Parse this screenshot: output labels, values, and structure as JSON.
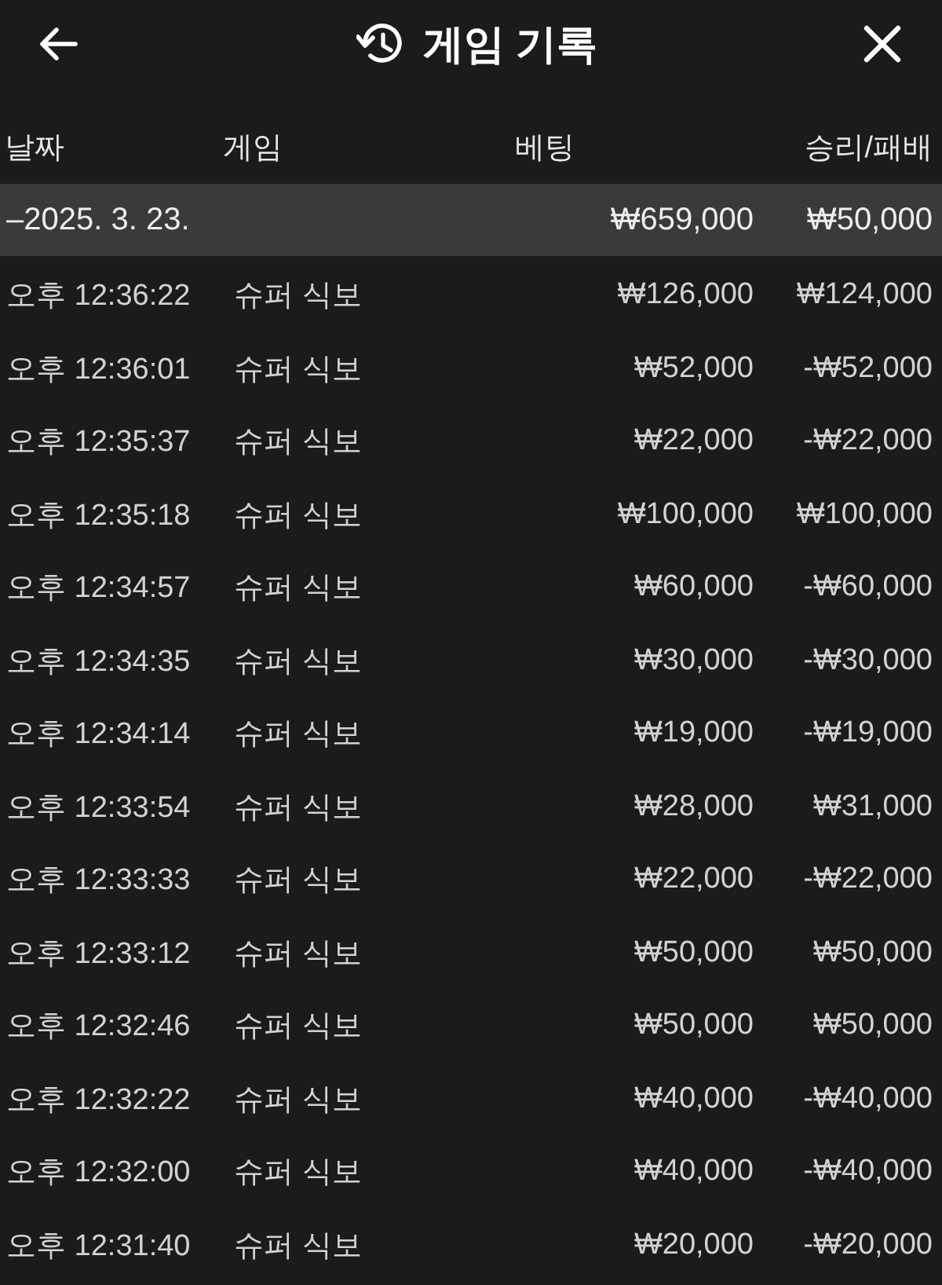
{
  "header": {
    "title": "게임 기록"
  },
  "columns": [
    "날짜",
    "게임",
    "베팅",
    "승리/패배"
  ],
  "groups": [
    {
      "date": "–2025. 3. 23.",
      "bet_total": "₩659,000",
      "result_total": "₩50,000",
      "rows": [
        {
          "time": "오후 12:36:22",
          "game": "슈퍼 식보",
          "bet": "₩126,000",
          "result": "₩124,000"
        },
        {
          "time": "오후 12:36:01",
          "game": "슈퍼 식보",
          "bet": "₩52,000",
          "result": "-₩52,000"
        },
        {
          "time": "오후 12:35:37",
          "game": "슈퍼 식보",
          "bet": "₩22,000",
          "result": "-₩22,000"
        },
        {
          "time": "오후 12:35:18",
          "game": "슈퍼 식보",
          "bet": "₩100,000",
          "result": "₩100,000"
        },
        {
          "time": "오후 12:34:57",
          "game": "슈퍼 식보",
          "bet": "₩60,000",
          "result": "-₩60,000"
        },
        {
          "time": "오후 12:34:35",
          "game": "슈퍼 식보",
          "bet": "₩30,000",
          "result": "-₩30,000"
        },
        {
          "time": "오후 12:34:14",
          "game": "슈퍼 식보",
          "bet": "₩19,000",
          "result": "-₩19,000"
        },
        {
          "time": "오후 12:33:54",
          "game": "슈퍼 식보",
          "bet": "₩28,000",
          "result": "₩31,000"
        },
        {
          "time": "오후 12:33:33",
          "game": "슈퍼 식보",
          "bet": "₩22,000",
          "result": "-₩22,000"
        },
        {
          "time": "오후 12:33:12",
          "game": "슈퍼 식보",
          "bet": "₩50,000",
          "result": "₩50,000"
        },
        {
          "time": "오후 12:32:46",
          "game": "슈퍼 식보",
          "bet": "₩50,000",
          "result": "₩50,000"
        },
        {
          "time": "오후 12:32:22",
          "game": "슈퍼 식보",
          "bet": "₩40,000",
          "result": "-₩40,000"
        },
        {
          "time": "오후 12:32:00",
          "game": "슈퍼 식보",
          "bet": "₩40,000",
          "result": "-₩40,000"
        },
        {
          "time": "오후 12:31:40",
          "game": "슈퍼 식보",
          "bet": "₩20,000",
          "result": "-₩20,000"
        }
      ]
    }
  ]
}
